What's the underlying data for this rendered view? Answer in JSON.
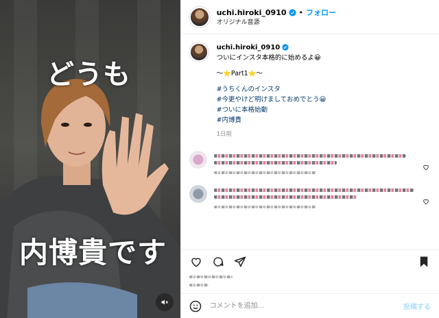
{
  "media": {
    "overlay_top": "どうも",
    "overlay_bottom": "内博貴です",
    "mute_icon": "speaker-muted-icon"
  },
  "header": {
    "username": "uchi.hiroki_0910",
    "separator": "•",
    "follow_label": "フォロー",
    "audio_label": "オリジナル音源",
    "more_label": "…"
  },
  "caption": {
    "username": "uchi.hiroki_0910",
    "line1": "ついにインスタ本格的に始めるよ😀",
    "line2": "〜⭐Part1⭐〜",
    "hashtags": [
      "#うちくんのインスタ",
      "#今更やけど明けましておめでとう😀",
      "#ついに本格始動",
      "#内博貴"
    ],
    "time": "1日前"
  },
  "comment_bar": {
    "placeholder": "コメントを追加...",
    "post_label": "投稿する"
  },
  "colors": {
    "link": "#0095f6",
    "hashtag": "#00376b",
    "muted": "#8e8e8e"
  }
}
